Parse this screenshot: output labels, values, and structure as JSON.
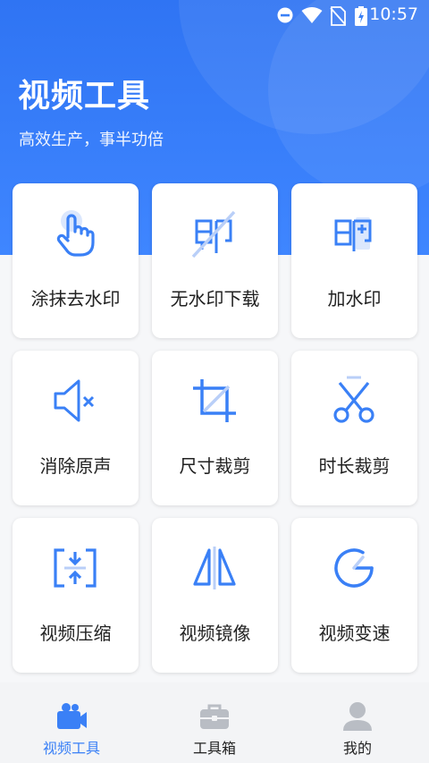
{
  "status_bar": {
    "time": "10:57"
  },
  "header": {
    "title": "视频工具",
    "subtitle": "高效生产，事半功倍"
  },
  "tools": [
    {
      "label": "涂抹去水印",
      "icon": "tap-hand-icon"
    },
    {
      "label": "无水印下载",
      "icon": "no-watermark-icon"
    },
    {
      "label": "加水印",
      "icon": "add-watermark-icon"
    },
    {
      "label": "消除原声",
      "icon": "mute-icon"
    },
    {
      "label": "尺寸裁剪",
      "icon": "crop-icon"
    },
    {
      "label": "时长裁剪",
      "icon": "scissors-icon"
    },
    {
      "label": "视频压缩",
      "icon": "compress-icon"
    },
    {
      "label": "视频镜像",
      "icon": "mirror-icon"
    },
    {
      "label": "视频变速",
      "icon": "speed-icon"
    }
  ],
  "tabs": [
    {
      "label": "视频工具",
      "icon": "video-camera-icon",
      "active": true
    },
    {
      "label": "工具箱",
      "icon": "toolbox-icon",
      "active": false
    },
    {
      "label": "我的",
      "icon": "user-icon",
      "active": false
    }
  ],
  "colors": {
    "accent": "#3a80f6",
    "header": "#3a80f6",
    "tab_inactive": "#b9bdc4"
  }
}
